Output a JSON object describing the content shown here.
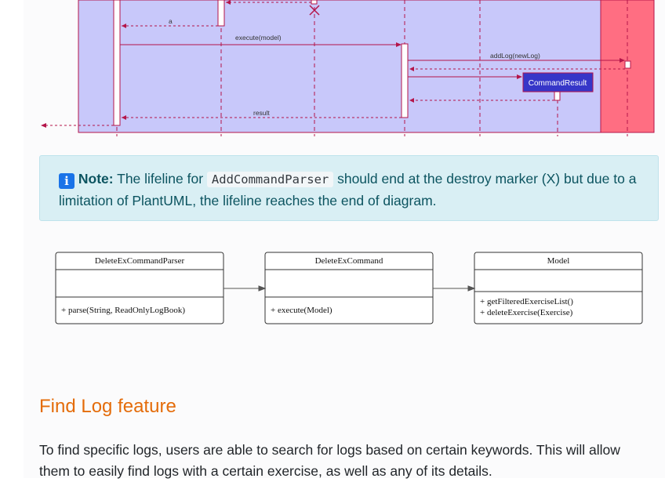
{
  "sequence_diagram": {
    "messages": {
      "a": "a",
      "execute": "execute(model)",
      "add_log": "addLog(newLog)",
      "result": "result"
    },
    "participants": {
      "command_result": "CommandResult"
    },
    "colors": {
      "logic_bg": "#c8c8fa",
      "model_bg": "#ff6e82",
      "arrow": "#b4154a",
      "command_result_box": "#3636c8"
    }
  },
  "note": {
    "icon": "info-icon",
    "label": "Note:",
    "text_before": " The lifeline for ",
    "code": "AddCommandParser",
    "text_after": " should end at the destroy marker (X) but due to a limitation of PlantUML, the lifeline reaches the end of diagram."
  },
  "class_diagram": {
    "classes": [
      {
        "name": "DeleteExCommandParser",
        "methods": [
          "+ parse(String, ReadOnlyLogBook)"
        ]
      },
      {
        "name": "DeleteExCommand",
        "methods": [
          "+ execute(Model)"
        ]
      },
      {
        "name": "Model",
        "methods": [
          "+ getFilteredExerciseList()",
          "+ deleteExercise(Exercise)"
        ]
      }
    ]
  },
  "section": {
    "title": "Find Log feature",
    "paragraph": "To find specific logs, users are able to search for logs based on certain keywords. This will allow them to easily find logs with a certain exercise, as well as any of its details."
  }
}
